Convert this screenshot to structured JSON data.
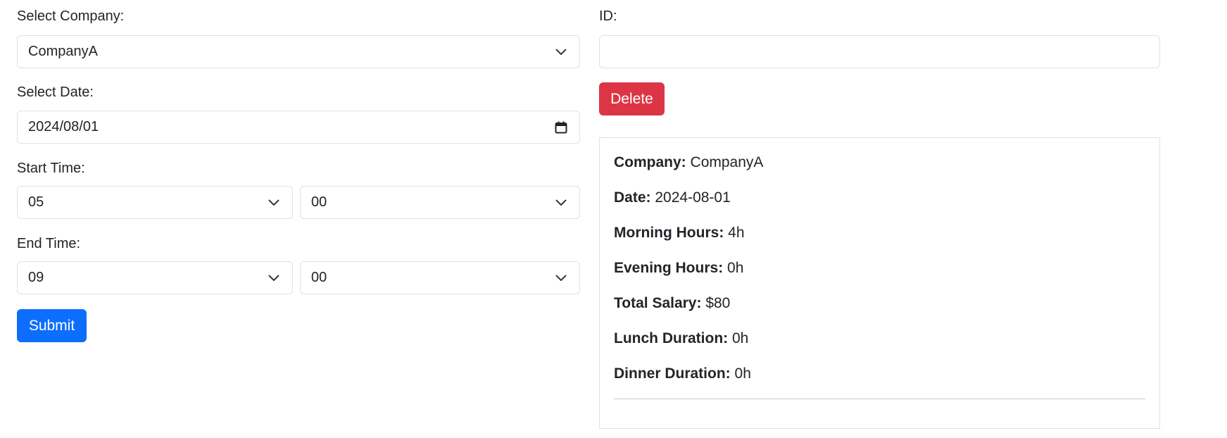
{
  "form": {
    "company_label": "Select Company:",
    "company_value": "CompanyA",
    "date_label": "Select Date:",
    "date_value": "2024/08/01",
    "start_label": "Start Time:",
    "start_hour": "05",
    "start_minute": "00",
    "end_label": "End Time:",
    "end_hour": "09",
    "end_minute": "00",
    "submit_label": "Submit"
  },
  "delete_panel": {
    "id_label": "ID:",
    "id_value": "",
    "delete_label": "Delete"
  },
  "result": {
    "company_key": "Company:",
    "company_value": "CompanyA",
    "date_key": "Date:",
    "date_value": "2024-08-01",
    "morning_key": "Morning Hours:",
    "morning_value": "4h",
    "evening_key": "Evening Hours:",
    "evening_value": "0h",
    "salary_key": "Total Salary:",
    "salary_value": "$80",
    "lunch_key": "Lunch Duration:",
    "lunch_value": "0h",
    "dinner_key": "Dinner Duration:",
    "dinner_value": "0h"
  },
  "colors": {
    "primary": "#0d6efd",
    "danger": "#dc3545",
    "border": "#dee2e6"
  },
  "icons": {
    "select_arrow": "chevron-down-icon",
    "date_picker": "calendar-icon"
  }
}
